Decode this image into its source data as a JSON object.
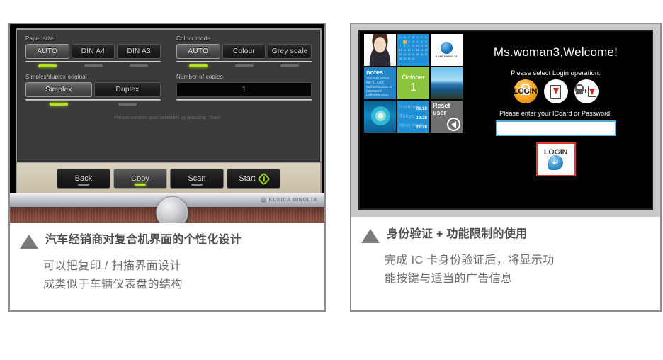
{
  "left_panel": {
    "copier_ui": {
      "paper_size": {
        "label": "Paper size",
        "options": [
          "AUTO",
          "DIN A4",
          "DIN A3"
        ],
        "selected_index": 0
      },
      "colour_mode": {
        "label": "Colour mode",
        "options": [
          "AUTO",
          "Colour",
          "Grey scale"
        ],
        "selected_index": 0
      },
      "simplex_duplex": {
        "label": "Simplex/duplex original",
        "options": [
          "Simplex",
          "Duplex"
        ],
        "selected_index": 0
      },
      "copies": {
        "label": "Number of copies",
        "value": "1"
      },
      "hint": "Please confirm your selection by pressing \"Start\".",
      "action_buttons": [
        {
          "label": "Back",
          "selected": false
        },
        {
          "label": "Copy",
          "selected": true
        },
        {
          "label": "Scan",
          "selected": false
        },
        {
          "label": "Start",
          "selected": false,
          "icon": "power-icon"
        }
      ],
      "brand": "KONICA MINOLTA"
    },
    "caption": {
      "title": "汽车经销商对复合机界面的个性化设计",
      "line1": "可以把复印 / 扫描界面设计",
      "line2": "成类似于车辆仪表盘的结构"
    }
  },
  "right_panel": {
    "screen": {
      "tiles": {
        "photo_alt": "user-portrait",
        "calendar": {
          "days": [
            "S",
            "M",
            "T",
            "W",
            "T",
            "F",
            "S",
            "",
            "1",
            "2",
            "3",
            "4",
            "5",
            "6",
            "7",
            "8",
            "9",
            "10",
            "11",
            "12",
            "13",
            "14",
            "15",
            "16",
            "17",
            "18",
            "19",
            "20",
            "21",
            "22",
            "23",
            "24",
            "25",
            "26",
            "27",
            "28",
            "29",
            "30",
            "31",
            "",
            "",
            ""
          ],
          "highlight": "1"
        },
        "brand": "KONICA MINOLTA",
        "notes": {
          "heading": "notes",
          "body": "You can select the IC card authentication or password authentication."
        },
        "date": {
          "month": "October",
          "day": "1"
        },
        "world_clock": [
          {
            "city": "London",
            "time": "02:28"
          },
          {
            "city": "Tokyo",
            "time": "10:28"
          },
          {
            "city": "New York",
            "time": "21:28"
          }
        ],
        "reset_user": {
          "line1": "Reset",
          "line2": "user",
          "icon": "back-arrow-icon"
        }
      },
      "welcome": "Ms.woman3,Welcome!",
      "select_prompt": "Please select Login operation.",
      "login_methods": [
        {
          "name": "password-login",
          "label": "LOGIN"
        },
        {
          "name": "ic-card-login",
          "label": ""
        },
        {
          "name": "ic-card-and-password-login",
          "label": "+"
        }
      ],
      "enter_prompt": "Please enter your ICoard or Password.",
      "password_value": "",
      "login_button": {
        "label": "LOGIN"
      }
    },
    "caption": {
      "title": "身份验证 + 功能限制的使用",
      "line1": "完成 IC 卡身份验证后，将显示功",
      "line2": "能按键与适当的广告信息"
    }
  },
  "colors": {
    "accent_green": "#b5e125",
    "accent_blue": "#1f8fd6",
    "accent_orange": "#f5a31e",
    "accent_red": "#e03b33",
    "caption_text": "#6a6a6a",
    "panel_border": "#8e8e8e"
  }
}
